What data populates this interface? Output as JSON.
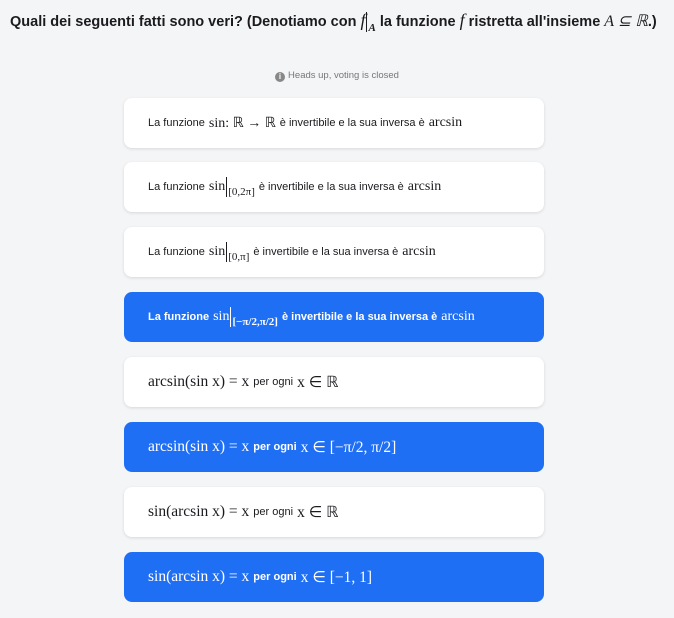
{
  "question": {
    "prefix": "Quali dei seguenti fatti sono veri? (Denotiamo con",
    "f": "f",
    "restrict_sub": "A",
    "mid1": "la funzione",
    "f2": "f",
    "mid2": "ristretta all'insieme",
    "set": "A ⊆ ℝ",
    "suffix": ".)"
  },
  "notice": {
    "icon": "info-icon",
    "text": "Heads up, voting is closed"
  },
  "options": [
    {
      "selected": false,
      "t1": "La funzione",
      "m1": "sin: ℝ → ℝ",
      "t2": "è invertibile e la sua inversa è",
      "m2": "arcsin"
    },
    {
      "selected": false,
      "t1": "La funzione",
      "m1": "sin",
      "sub": "[0,2π]",
      "t2": "è invertibile e la sua inversa è",
      "m2": "arcsin"
    },
    {
      "selected": false,
      "t1": "La funzione",
      "m1": "sin",
      "sub": "[0,π]",
      "t2": "è invertibile e la sua inversa è",
      "m2": "arcsin"
    },
    {
      "selected": true,
      "t1": "La funzione",
      "m1": "sin",
      "sub": "[−π/2,π/2]",
      "t2": "è invertibile e la sua inversa è",
      "m2": "arcsin"
    },
    {
      "selected": false,
      "m1": "arcsin(sin x) = x",
      "t1": "per ogni",
      "m2": "x ∈ ℝ"
    },
    {
      "selected": true,
      "m1": "arcsin(sin x) = x",
      "t1": "per ogni",
      "m2": "x ∈ [−π/2, π/2]"
    },
    {
      "selected": false,
      "m1": "sin(arcsin x) = x",
      "t1": "per ogni",
      "m2": "x ∈ ℝ"
    },
    {
      "selected": true,
      "m1": "sin(arcsin x) = x",
      "t1": "per ogni",
      "m2": "x ∈ [−1, 1]"
    }
  ]
}
